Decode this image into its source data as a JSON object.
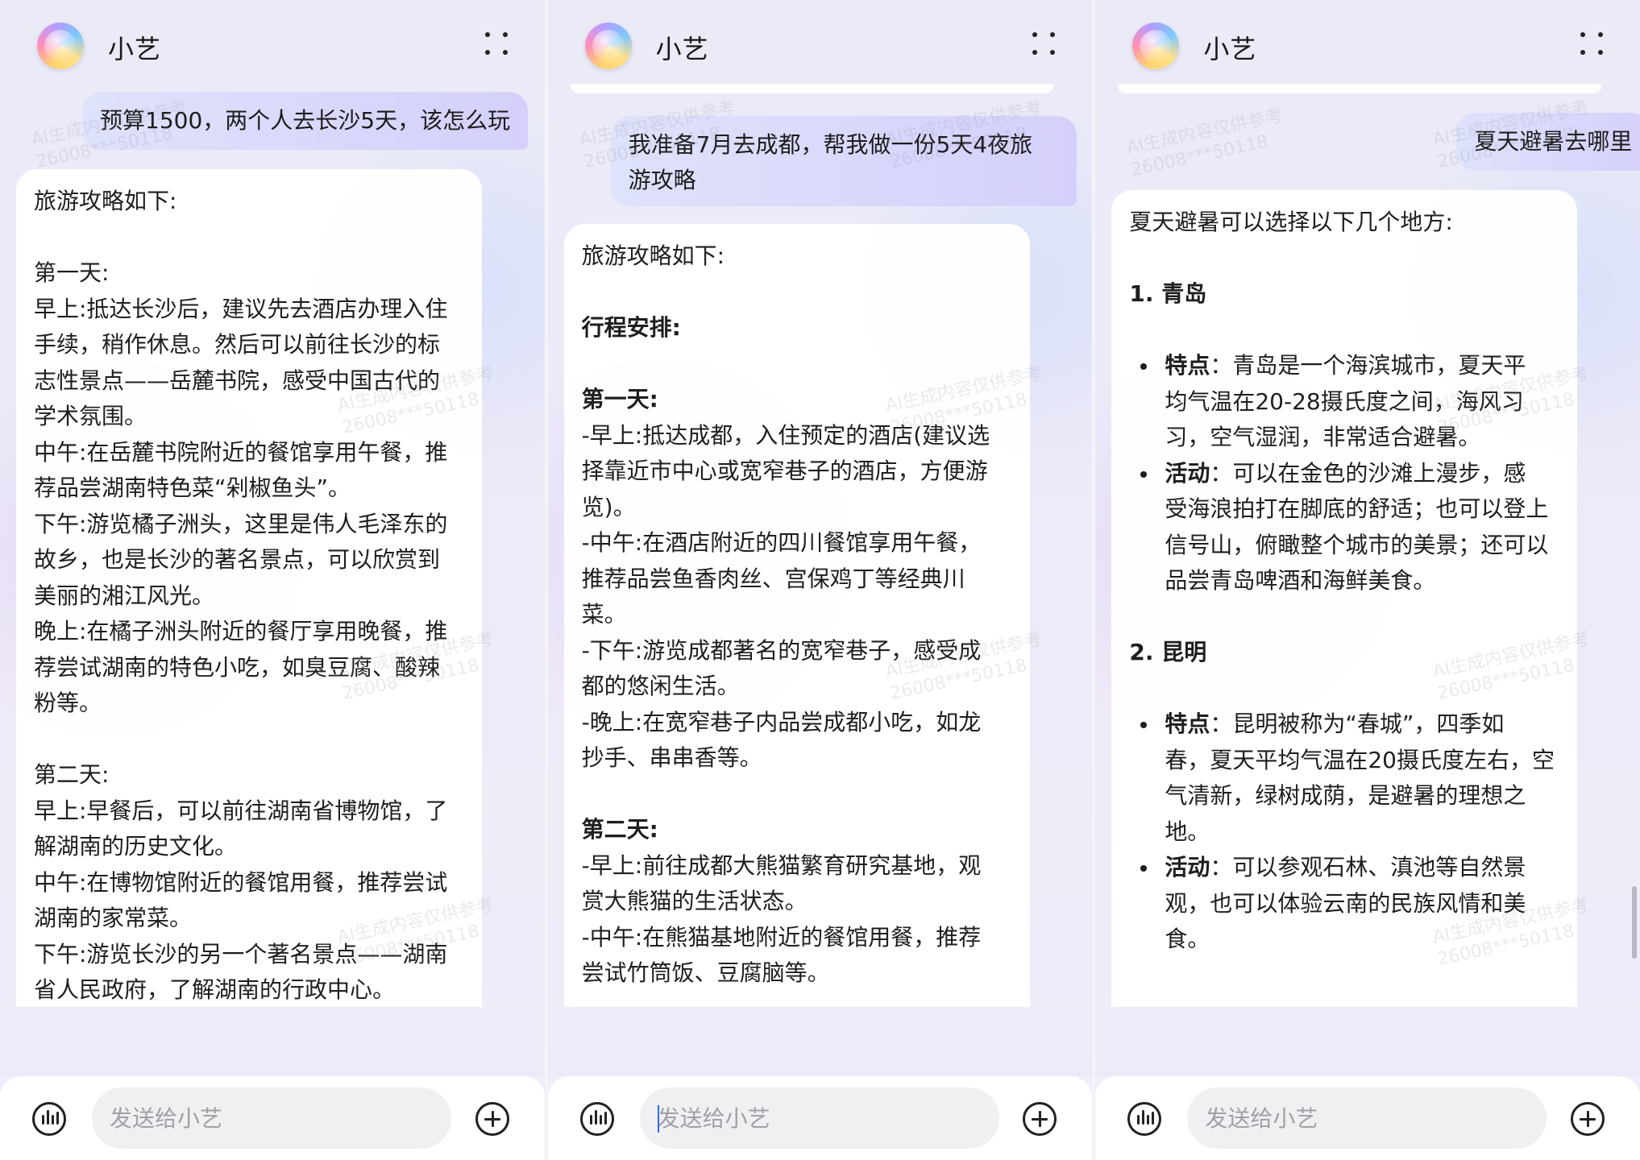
{
  "app_title": "小艺",
  "input_placeholder": "发送给小艺",
  "watermark_line1": "AI生成内容仅供参考",
  "watermark_line2": "26008***50118",
  "panels": [
    {
      "user_message": [
        "预算1500，两个人去长沙5天，该怎么玩"
      ],
      "response": [
        "旅游攻略如下:",
        "",
        "第一天:",
        "早上:抵达长沙后，建议先去酒店办理入住",
        "手续，稍作休息。然后可以前往长沙的标",
        "志性景点——岳麓书院，感受中国古代的",
        "学术氛围。",
        "中午:在岳麓书院附近的餐馆享用午餐，推",
        "荐品尝湖南特色菜“剁椒鱼头”。",
        "下午:游览橘子洲头，这里是伟人毛泽东的",
        "故乡，也是长沙的著名景点，可以欣赏到",
        "美丽的湘江风光。",
        "晚上:在橘子洲头附近的餐厅享用晚餐，推",
        "荐尝试湖南的特色小吃，如臭豆腐、酸辣",
        "粉等。",
        "",
        "第二天:",
        "早上:早餐后，可以前往湖南省博物馆，了",
        "解湖南的历史文化。",
        "中午:在博物馆附近的餐馆用餐，推荐尝试",
        "湖南的家常菜。",
        "下午:游览长沙的另一个著名景点——湖南",
        "省人民政府，了解湖南的行政中心。"
      ]
    },
    {
      "user_message": [
        "我准备7月去成都，帮我做一份5天4夜旅",
        "游攻略"
      ],
      "response": [
        "旅游攻略如下:",
        "",
        "行程安排:",
        "",
        "第一天:",
        "-早上:抵达成都，入住预定的酒店(建议选",
        "择靠近市中心或宽窄巷子的酒店，方便游",
        "览)。",
        "-中午:在酒店附近的四川餐馆享用午餐，",
        "推荐品尝鱼香肉丝、宫保鸡丁等经典川",
        "菜。",
        "-下午:游览成都著名的宽窄巷子，感受成",
        "都的悠闲生活。",
        "-晚上:在宽窄巷子内品尝成都小吃，如龙",
        "抄手、串串香等。",
        "",
        "第二天:",
        "-早上:前往成都大熊猫繁育研究基地，观",
        "赏大熊猫的生活状态。",
        "-中午:在熊猫基地附近的餐馆用餐，推荐",
        "尝试竹筒饭、豆腐脑等。"
      ]
    },
    {
      "user_message": [
        "夏天避暑去哪里"
      ],
      "intro": "夏天避暑可以选择以下几个地方:",
      "sections": [
        {
          "heading": "1. 青岛",
          "bullets": [
            {
              "label": "特点",
              "sep": "：",
              "lines": [
                "青岛是一个海滨城市，夏天平",
                "均气温在20-28摄氏度之间，海风习",
                "习，空气湿润，非常适合避暑。"
              ]
            },
            {
              "label": "活动",
              "sep": "：",
              "lines": [
                "可以在金色的沙滩上漫步，感",
                "受海浪拍打在脚底的舒适；也可以登上",
                "信号山，俯瞰整个城市的美景；还可以",
                "品尝青岛啤酒和海鲜美食。"
              ]
            }
          ]
        },
        {
          "heading": "2. 昆明",
          "bullets": [
            {
              "label": "特点",
              "sep": "：",
              "lines": [
                "昆明被称为“春城”，四季如",
                "春，夏天平均气温在20摄氏度左右，空",
                "气清新，绿树成荫，是避暑的理想之",
                "地。"
              ]
            },
            {
              "label": "活动",
              "sep": "：",
              "lines": [
                "可以参观石林、滇池等自然景",
                "观，也可以体验云南的民族风情和美",
                "食。"
              ]
            }
          ]
        }
      ]
    }
  ]
}
